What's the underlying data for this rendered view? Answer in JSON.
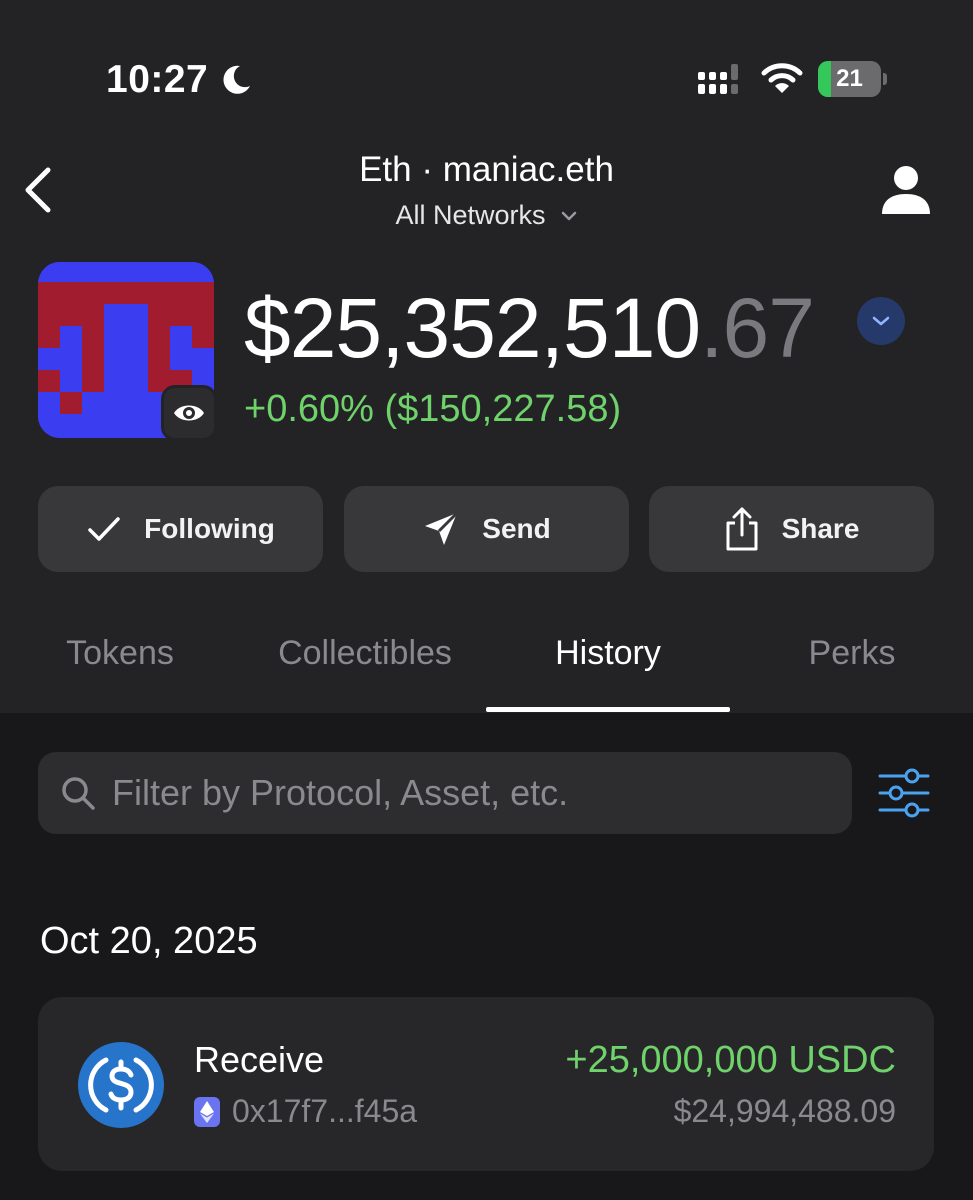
{
  "status_bar": {
    "time": "10:27",
    "battery_level": "21",
    "battery_fraction": 0.21
  },
  "header": {
    "title": "Eth · maniac.eth",
    "network_selector": "All Networks"
  },
  "portfolio": {
    "balance_main": "$25,352,510",
    "balance_cents": ".67",
    "change": "+0.60% ($150,227.58)"
  },
  "actions": {
    "following_label": "Following",
    "send_label": "Send",
    "share_label": "Share"
  },
  "tabs": [
    {
      "label": "Tokens",
      "active": false
    },
    {
      "label": "Collectibles",
      "active": false
    },
    {
      "label": "History",
      "active": true
    },
    {
      "label": "Perks",
      "active": false
    }
  ],
  "search": {
    "placeholder": "Filter by Protocol, Asset, etc.",
    "value": ""
  },
  "history": {
    "groups": [
      {
        "date": "Oct 20, 2025",
        "transactions": [
          {
            "type": "Receive",
            "address": "0x17f7...f45a",
            "amount": "+25,000,000 USDC",
            "usd_value": "$24,994,488.09",
            "token_icon": "usdc-icon",
            "network_icon": "ethereum-icon"
          }
        ]
      }
    ]
  },
  "colors": {
    "positive": "#6fd26b",
    "accent_blue": "#4aa3f0",
    "background_top": "#232326",
    "background_bottom": "#18181b",
    "usdc_blue": "#2775ca"
  },
  "icons": {
    "back": "chevron-left-icon",
    "profile": "person-icon",
    "balance_toggle": "chevron-down-icon",
    "watch": "eye-icon",
    "following": "checkmark-icon",
    "send": "paper-plane-icon",
    "share": "share-icon",
    "search": "search-icon",
    "filter": "sliders-icon"
  }
}
